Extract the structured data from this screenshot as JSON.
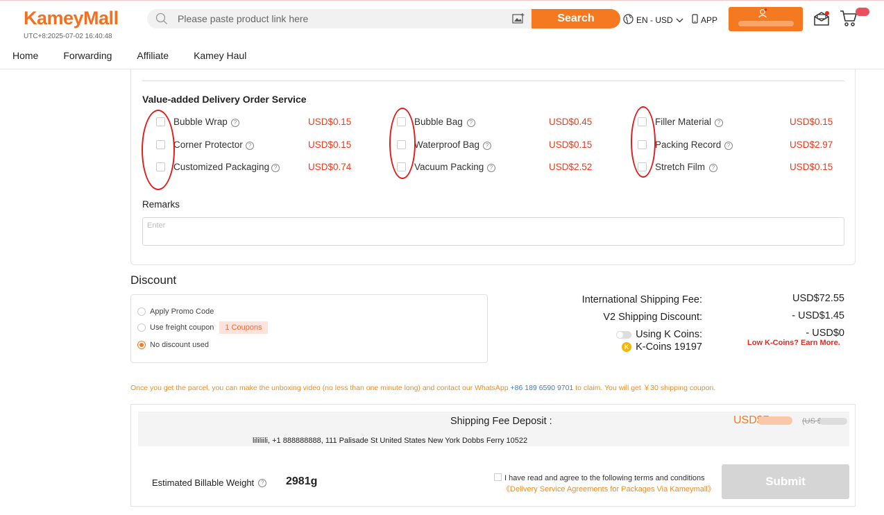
{
  "header": {
    "logo": "KameyMall",
    "clock": "UTC+8:2025-07-02 16:40:48",
    "search_placeholder": "Please paste product link here",
    "search_button": "Search",
    "language": "EN - USD",
    "app": "APP",
    "nav": [
      "Home",
      "Forwarding",
      "Affiliate",
      "Kamey Haul"
    ]
  },
  "value_added": {
    "title": "Value-added Delivery Order Service",
    "columns": [
      [
        {
          "name": "Bubble Wrap",
          "price": "USD$0.15"
        },
        {
          "name": "Corner Protector",
          "price": "USD$0.15"
        },
        {
          "name": "Customized Packaging",
          "price": "USD$0.74"
        }
      ],
      [
        {
          "name": "Bubble Bag",
          "price": "USD$0.45"
        },
        {
          "name": "Waterproof Bag",
          "price": "USD$0.15"
        },
        {
          "name": "Vacuum Packing",
          "price": "USD$2.52"
        }
      ],
      [
        {
          "name": "Filler Material",
          "price": "USD$0.15"
        },
        {
          "name": "Packing Record",
          "price": "USD$2.97"
        },
        {
          "name": "Stretch Film",
          "price": "USD$0.15"
        }
      ]
    ],
    "remarks_label": "Remarks",
    "remarks_placeholder": "Enter"
  },
  "discount": {
    "title": "Discount",
    "options": [
      "Apply Promo Code",
      "Use freight coupon",
      "No discount used"
    ],
    "coupon_tag": "1 Coupons",
    "selected": "No discount used"
  },
  "fees": {
    "intl_label": "International Shipping Fee:",
    "intl_value": "USD$72.55",
    "v2_label": "V2 Shipping Discount:",
    "v2_value": "- USD$1.45",
    "kcoins_label": "Using K Coins:",
    "kcoins_value": "- USD$0",
    "kcoins_balance": "K-Coins 19197",
    "earn_more": "Low K-Coins? Earn More."
  },
  "notice": {
    "text_before": "Once you get the parcel, you can make the unboxing video (no less than one minute long) and contact our WhatsApp",
    "phone": "+86 189 6590 9701",
    "text_after": "to claim. You will get ￥30 shipping coupon."
  },
  "summary": {
    "deposit_label": "Shipping Fee Deposit :",
    "deposit_value": "USD$7",
    "deposit_strike": "(US $",
    "address": "lililiili, +1 888888888,  111 Palisade St   United States New York Dobbs Ferry 10522",
    "weight_label": "Estimated Billable Weight",
    "weight_value": "2981g",
    "agree_text": "I have read and agree to the following terms and conditions",
    "agree_link": "《Delivery Service Agreements for Packages Via Kameymall》",
    "submit": "Submit"
  },
  "colors": {
    "brand": "#f47920",
    "price": "#ee3a1b",
    "annotation": "#e31c1c"
  }
}
